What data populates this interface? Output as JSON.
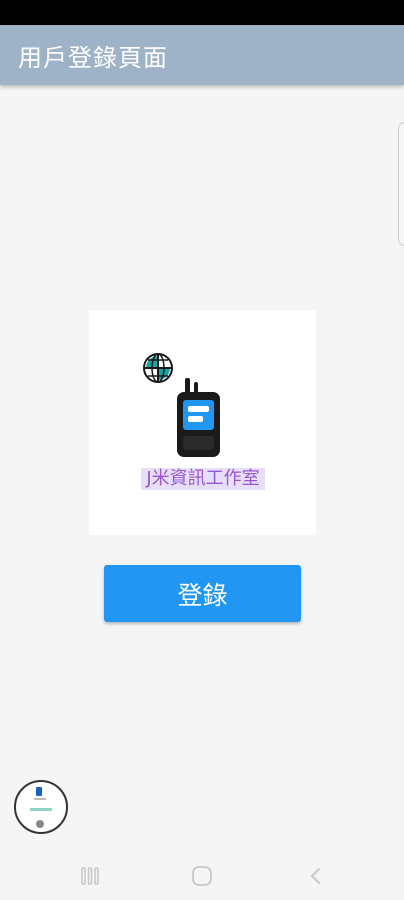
{
  "app_bar": {
    "title": "用戶登錄頁面"
  },
  "logo": {
    "brand_text": "J米資訊工作室",
    "icons": [
      "globe-icon",
      "walkie-talkie-icon"
    ],
    "colors": {
      "globe": "#1aa3a3",
      "radio_body": "#1a1a1a",
      "radio_screen": "#2196f3",
      "brand_text": "#9a55d3",
      "brand_highlight": "#e6dff5"
    }
  },
  "login": {
    "button_label": "登錄",
    "accent_color": "#2196f3"
  },
  "floating_bubble": {
    "icon": "app-preview-icon"
  },
  "navigation": {
    "buttons": [
      "recents-icon",
      "home-icon",
      "back-icon"
    ]
  }
}
